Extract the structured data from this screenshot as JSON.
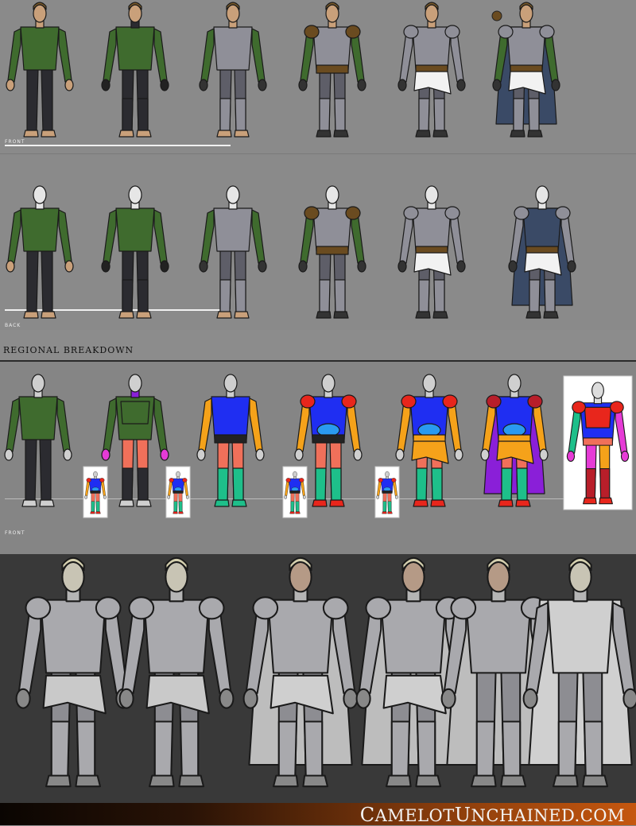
{
  "labels": {
    "front": "FRONT",
    "back": "BACK",
    "front2": "FRONT",
    "section_title": "REGIONAL BREAKDOWN",
    "site_name_c": "C",
    "site_name_amelot": "AMELOT",
    "site_name_u": "U",
    "site_name_nchained": "NCHAINED.COM"
  },
  "colors": {
    "tunic": "#3f6b2e",
    "tunic_dark": "#2e5121",
    "pants": "#2b2b30",
    "armor": "#8f8f98",
    "armor_dark": "#5e5e68",
    "leather": "#6a4b20",
    "cloth": "#f2f2f2",
    "cape": "#3a4a66",
    "skin": "#c9a07a",
    "head_white": "#e6e6e6",
    "r_blue": "#1f2ef2",
    "r_purple": "#8a1fd8",
    "r_red": "#e8261c",
    "r_orange": "#f5a21a",
    "r_teal": "#1ebf8a",
    "r_salmon": "#f0705a",
    "r_magenta": "#e63bd6",
    "r_sky": "#2a9af0",
    "r_darkred": "#b81e2a",
    "sculpt": "#a9a9ad"
  }
}
